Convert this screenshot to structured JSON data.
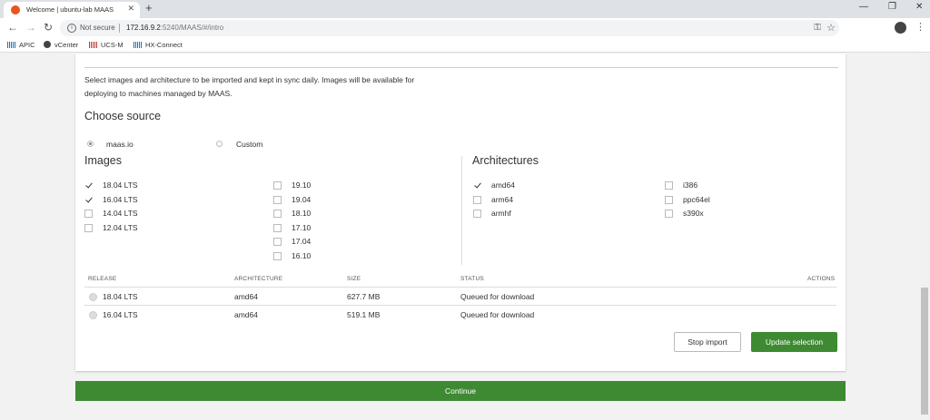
{
  "browser": {
    "tab_title": "Welcome | ubuntu-lab MAAS",
    "tab_close": "✕",
    "new_tab": "+",
    "minimize": "—",
    "restore": "❐",
    "close": "✕",
    "not_secure": "Not secure",
    "url_host": "172.16.9.2",
    "url_path": ":5240/MAAS/#/intro",
    "bookmarks": [
      "APIC",
      "vCenter",
      "UCS-M",
      "HX-Connect"
    ]
  },
  "intro": {
    "description": "Select images and architecture to be imported and kept in sync daily. Images will be available for deploying to machines managed by MAAS.",
    "choose_source": "Choose source",
    "source_options": [
      {
        "label": "maas.io",
        "selected": true
      },
      {
        "label": "Custom",
        "selected": false
      }
    ]
  },
  "images": {
    "title": "Images",
    "col1": [
      {
        "label": "18.04 LTS",
        "checked": true
      },
      {
        "label": "16.04 LTS",
        "checked": true
      },
      {
        "label": "14.04 LTS",
        "checked": false
      },
      {
        "label": "12.04 LTS",
        "checked": false
      }
    ],
    "col2": [
      {
        "label": "19.10",
        "checked": false
      },
      {
        "label": "19.04",
        "checked": false
      },
      {
        "label": "18.10",
        "checked": false
      },
      {
        "label": "17.10",
        "checked": false
      },
      {
        "label": "17.04",
        "checked": false
      },
      {
        "label": "16.10",
        "checked": false
      }
    ]
  },
  "architectures": {
    "title": "Architectures",
    "col1": [
      {
        "label": "amd64",
        "checked": true
      },
      {
        "label": "arm64",
        "checked": false
      },
      {
        "label": "armhf",
        "checked": false
      }
    ],
    "col2": [
      {
        "label": "i386",
        "checked": false
      },
      {
        "label": "ppc64el",
        "checked": false
      },
      {
        "label": "s390x",
        "checked": false
      }
    ]
  },
  "table": {
    "headers": {
      "release": "RELEASE",
      "architecture": "ARCHITECTURE",
      "size": "SIZE",
      "status": "STATUS",
      "actions": "ACTIONS"
    },
    "rows": [
      {
        "release": "18.04 LTS",
        "architecture": "amd64",
        "size": "627.7 MB",
        "status": "Queued for download"
      },
      {
        "release": "16.04 LTS",
        "architecture": "amd64",
        "size": "519.1 MB",
        "status": "Queued for download"
      }
    ]
  },
  "buttons": {
    "stop_import": "Stop import",
    "update_selection": "Update selection",
    "continue": "Continue"
  },
  "colors": {
    "accent_green": "#3e8a33",
    "ubuntu_orange": "#e95420"
  }
}
